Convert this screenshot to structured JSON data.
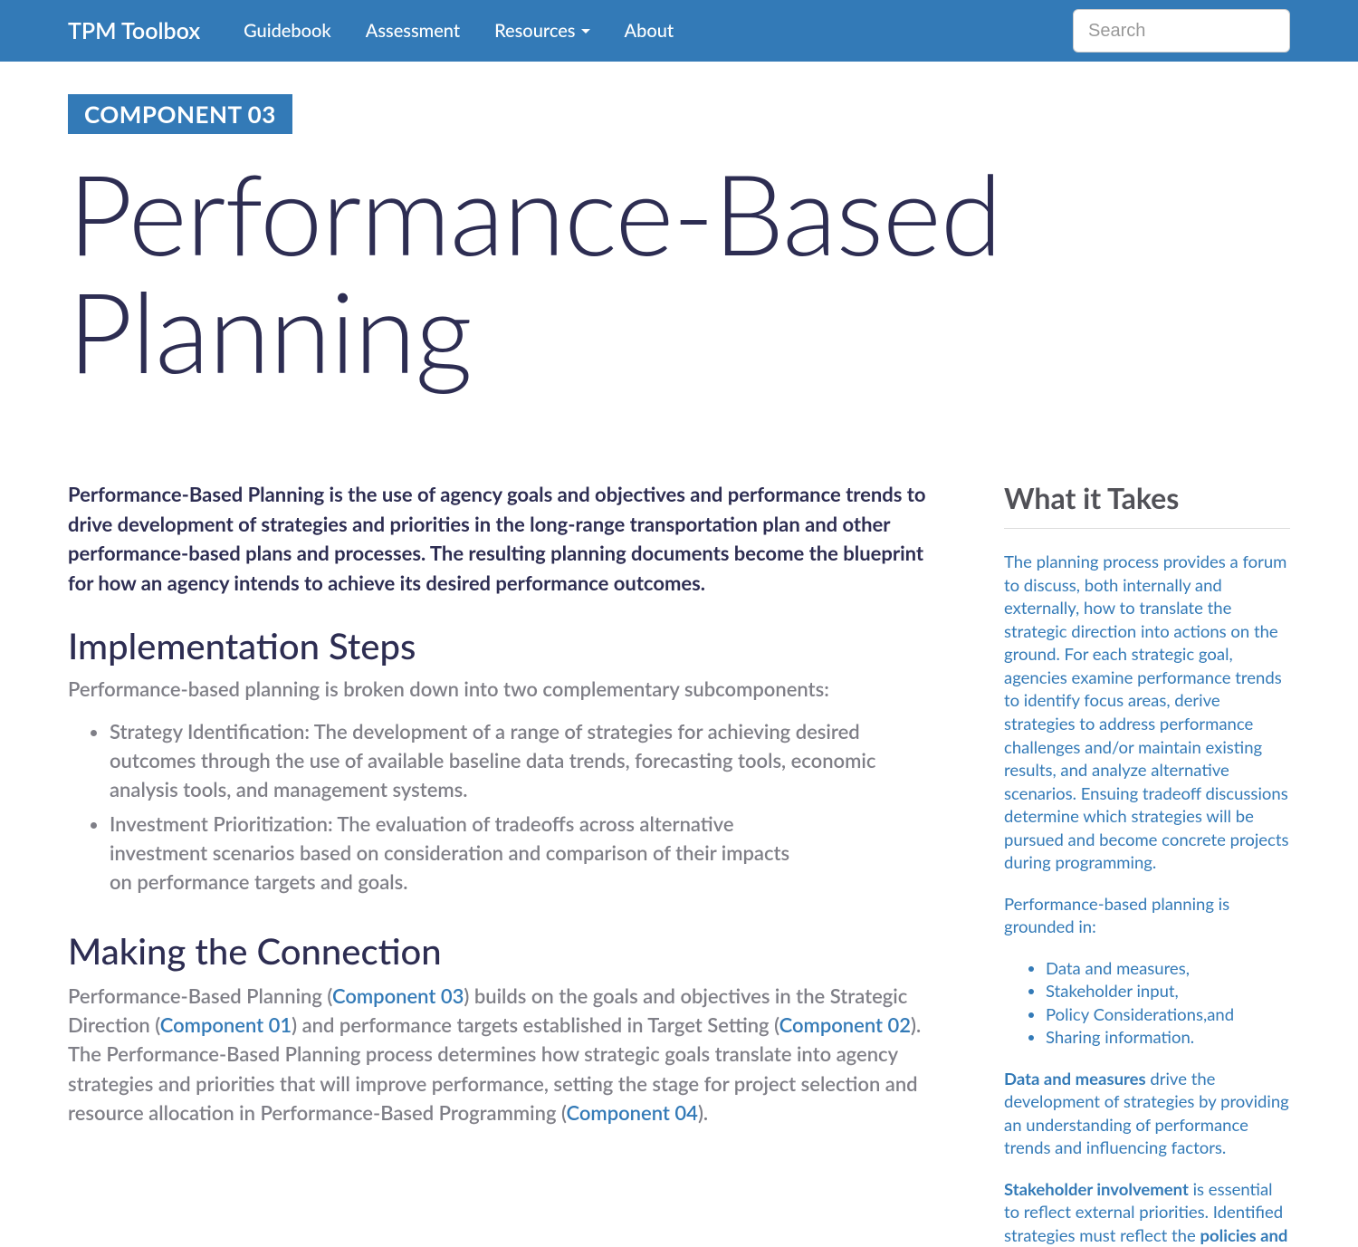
{
  "nav": {
    "brand": "TPM Toolbox",
    "links": [
      "Guidebook",
      "Assessment",
      "Resources",
      "About"
    ],
    "search_placeholder": "Search"
  },
  "badge": "COMPONENT 03",
  "title": "Performance-Based Planning",
  "lead": "Performance-Based Planning is the use of agency goals and objectives and performance trends to drive development of strategies and priorities in the long-range transportation plan and other performance-based plans and processes. The resulting planning documents become the blueprint for how an agency intends to achieve its desired performance outcomes.",
  "impl_heading": "Implementation Steps",
  "impl_intro": "Performance-based planning is broken down into two complementary subcomponents:",
  "impl_steps": [
    "Strategy Identification: The development of a range of strategies for achieving desired outcomes through the use of available baseline data trends, forecasting tools, economic analysis tools, and management systems.",
    "Investment Prioritization: The evaluation of tradeoffs across alternative investment scenarios based on consideration and comparison of their impacts on performance targets and goals."
  ],
  "conn_heading": "Making the Connection",
  "conn": {
    "t1": "Performance-Based Planning (",
    "l1": "Component 03",
    "t2": ") builds on the goals and objectives in the Strategic Direction (",
    "l2": "Component 01",
    "t3": ") and performance targets established in Target Setting (",
    "l3": "Component 02",
    "t4": "). The Performance-Based Planning process determines how strategic goals translate into agency strategies and priorities that will improve performance, setting the stage for project selection and resource allocation in Performance-Based Programming (",
    "l4": "Component 04",
    "t5": ")."
  },
  "sidebar": {
    "heading": "What it Takes",
    "p1": "The planning process provides a forum to discuss, both internally and externally, how to translate the strategic direction into actions on the ground. For each strategic goal, agencies examine performance trends to identify focus areas, derive strategies to address performance challenges and/or maintain existing results, and analyze alternative scenarios. Ensuing tradeoff discussions determine which strategies will be pursued and become concrete projects during programming.",
    "p2": "Performance-based planning is grounded in:",
    "list": [
      "Data and measures,",
      "Stakeholder input,",
      "Policy Considerations,and",
      "Sharing information."
    ],
    "p3_bold": "Data and measures",
    "p3_rest": " drive the development of strategies by providing an understanding of performance trends and influencing factors.",
    "p4_bold": "Stakeholder involvement",
    "p4_rest": " is essential to reflect external priorities. Identified strategies must reflect the ",
    "p4_bold2": "policies and"
  }
}
